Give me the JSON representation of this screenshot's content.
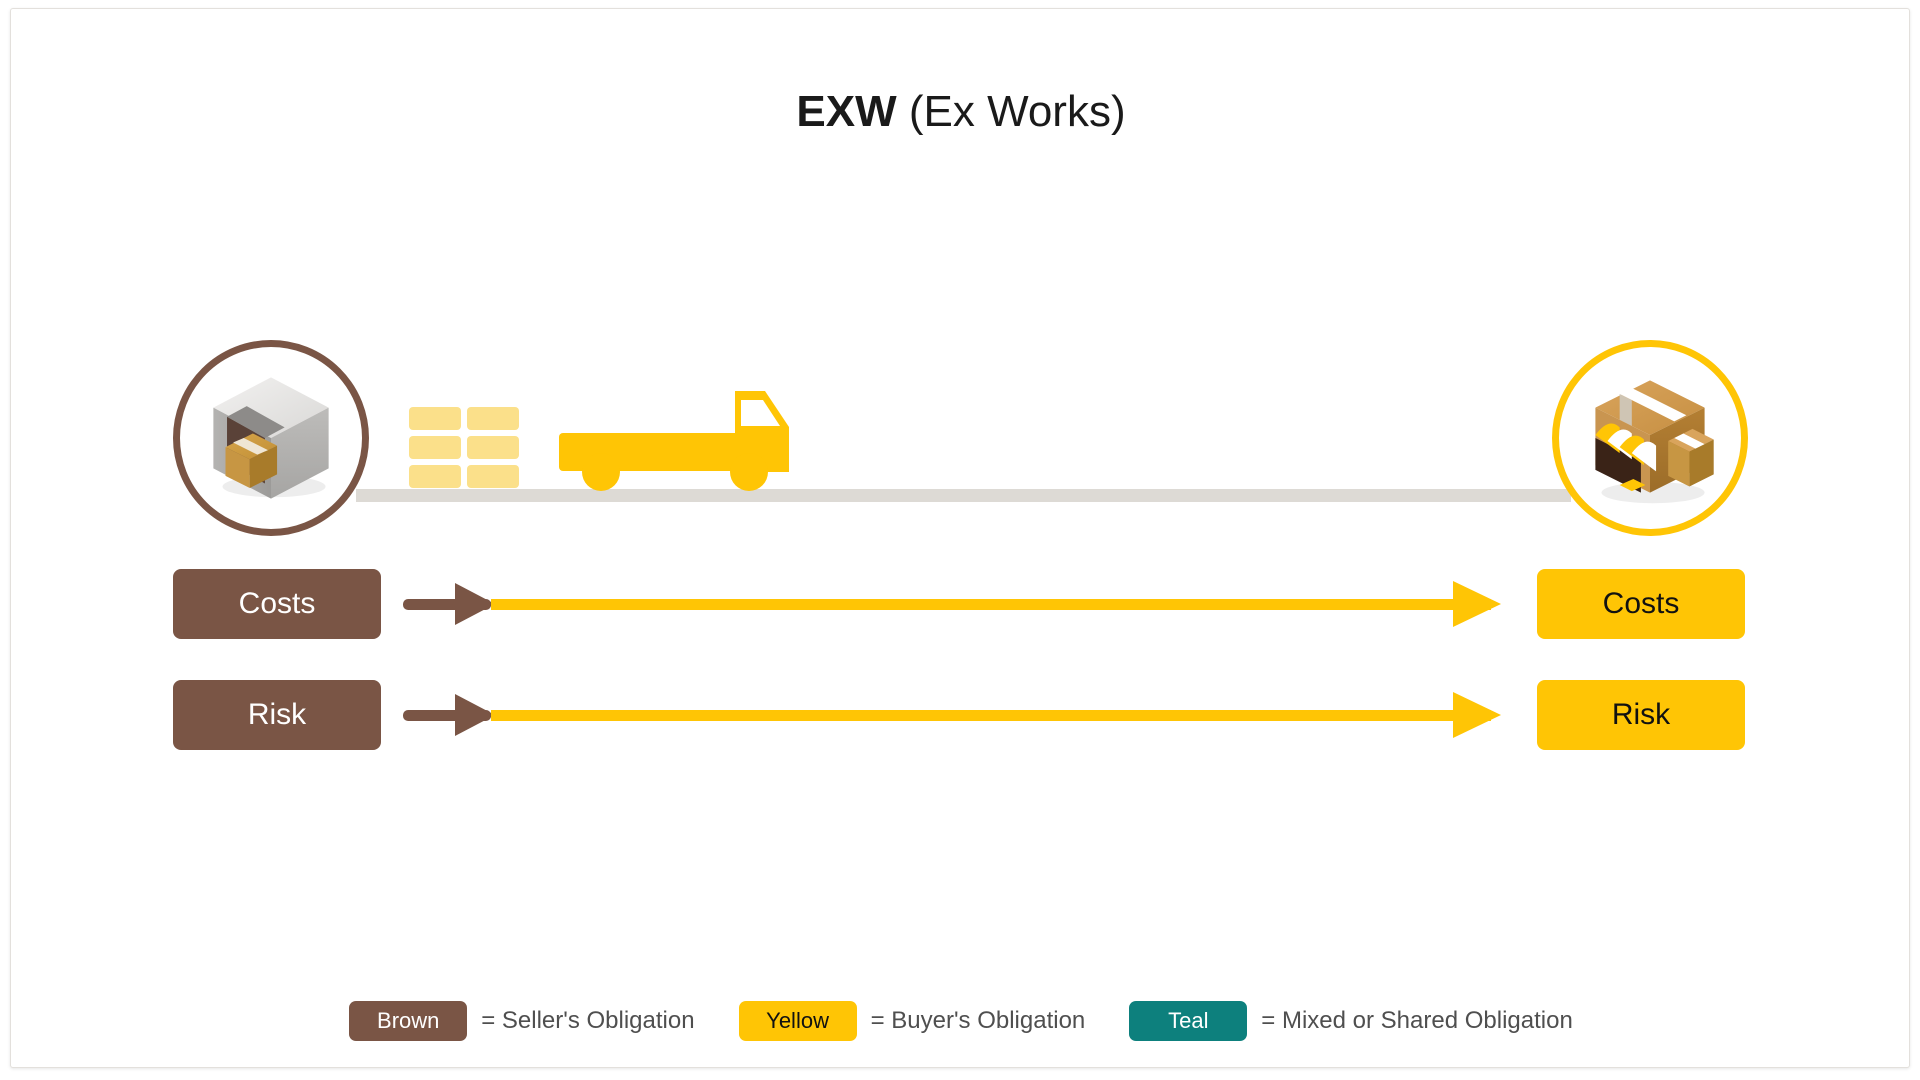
{
  "title": {
    "code": "EXW",
    "expansion": "(Ex Works)"
  },
  "scene": {
    "origin_node": {
      "icon": "warehouse-icon",
      "ring_color": "#7a5545"
    },
    "destination_node": {
      "icon": "storefront-icon",
      "ring_color": "#ffc505"
    },
    "pallet_stack": {
      "icon": "stacked-cargo-icon",
      "color": "#fbe08a",
      "rows": 3,
      "columns": 2
    },
    "truck": {
      "icon": "flatbed-truck-icon",
      "color": "#ffc505"
    },
    "ground_line_color": "#dddad5"
  },
  "rows": [
    {
      "id": "costs",
      "seller_label": "Costs",
      "buyer_label": "Costs",
      "seller_segment_color": "#7a5545",
      "buyer_segment_color": "#ffc505",
      "seller_share_percent": 9,
      "buyer_share_percent": 91
    },
    {
      "id": "risk",
      "seller_label": "Risk",
      "buyer_label": "Risk",
      "seller_segment_color": "#7a5545",
      "buyer_segment_color": "#ffc505",
      "seller_share_percent": 9,
      "buyer_share_percent": 91
    }
  ],
  "legend": {
    "items": [
      {
        "swatch_label": "Brown",
        "description": "= Seller's Obligation",
        "color": "#7a5545"
      },
      {
        "swatch_label": "Yellow",
        "description": "= Buyer's Obligation",
        "color": "#ffc505"
      },
      {
        "swatch_label": "Teal",
        "description": "= Mixed or Shared Obligation",
        "color": "#0d807d"
      }
    ]
  },
  "colors": {
    "brown": "#7a5545",
    "yellow": "#ffc505",
    "teal": "#0d807d",
    "ground": "#dddad5",
    "title": "#1a1a1a",
    "legend_text": "#4f4f4f"
  }
}
